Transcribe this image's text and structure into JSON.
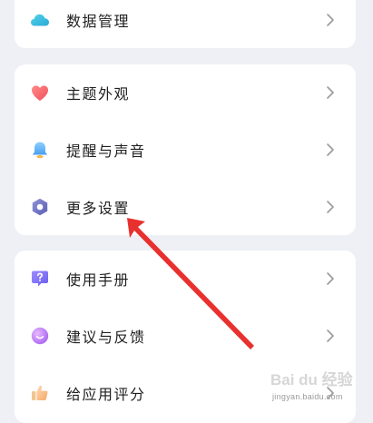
{
  "groups": [
    {
      "items": [
        {
          "label": "数据管理",
          "icon": "cloud-icon"
        }
      ]
    },
    {
      "items": [
        {
          "label": "主题外观",
          "icon": "heart-icon"
        },
        {
          "label": "提醒与声音",
          "icon": "bell-icon"
        },
        {
          "label": "更多设置",
          "icon": "hexagon-settings-icon"
        }
      ]
    },
    {
      "items": [
        {
          "label": "使用手册",
          "icon": "help-bubble-icon"
        },
        {
          "label": "建议与反馈",
          "icon": "feedback-bubble-icon"
        },
        {
          "label": "给应用评分",
          "icon": "thumbs-up-icon"
        }
      ]
    }
  ],
  "annotation": {
    "color": "#e8312f",
    "points_to": "更多设置"
  },
  "watermark": {
    "logo_text": "Bai du 经验",
    "url_text": "jingyan.baidu.com"
  },
  "colors": {
    "background": "#eef0f5",
    "card": "#ffffff",
    "text": "#1f1f1f",
    "chevron": "#9a9a9a"
  }
}
